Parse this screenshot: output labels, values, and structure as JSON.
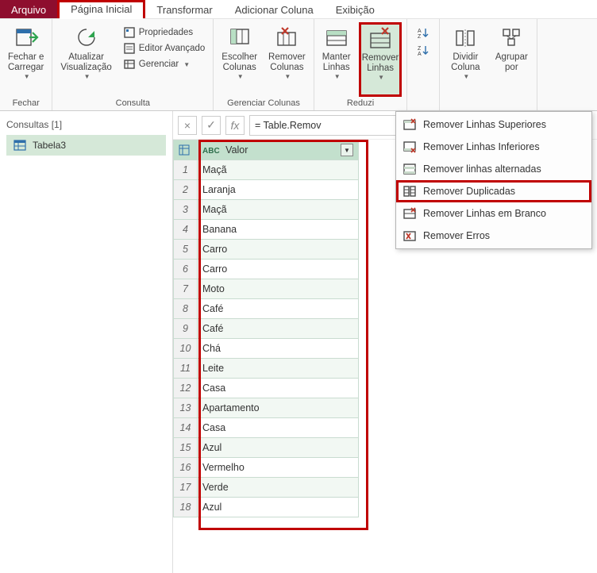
{
  "tabs": {
    "arquivo": "Arquivo",
    "pagina_inicial": "Página Inicial",
    "transformar": "Transformar",
    "adicionar_coluna": "Adicionar Coluna",
    "exibicao": "Exibição"
  },
  "ribbon": {
    "fechar": {
      "fechar_carregar": "Fechar e\nCarregar",
      "group_label": "Fechar"
    },
    "consulta": {
      "atualizar": "Atualizar\nVisualização",
      "propriedades": "Propriedades",
      "editor_avancado": "Editor Avançado",
      "gerenciar": "Gerenciar",
      "group_label": "Consulta"
    },
    "colunas": {
      "escolher": "Escolher\nColunas",
      "remover": "Remover\nColunas",
      "group_label": "Gerenciar Colunas"
    },
    "linhas": {
      "manter": "Manter\nLinhas",
      "remover": "Remover\nLinhas",
      "group_label": "Reduzi"
    },
    "ordem": {
      "dividir": "Dividir\nColuna",
      "agrupar": "Agrupar\npor"
    }
  },
  "dropdown": {
    "rem_superiores": "Remover Linhas Superiores",
    "rem_inferiores": "Remover Linhas Inferiores",
    "rem_alternadas": "Remover linhas alternadas",
    "rem_duplicadas": "Remover Duplicadas",
    "rem_branco": "Remover Linhas em Branco",
    "rem_erros": "Remover Erros"
  },
  "sidebar": {
    "title": "Consultas [1]",
    "query_name": "Tabela3"
  },
  "formula": {
    "text": "= Table.Remov"
  },
  "table": {
    "type_tag": "ABC",
    "column_header": "Valor",
    "rows": [
      "Maçã",
      "Laranja",
      "Maçã",
      "Banana",
      "Carro",
      "Carro",
      "Moto",
      "Café",
      "Café",
      "Chá",
      "Leite",
      "Casa",
      "Apartamento",
      "Casa",
      "Azul",
      "Vermelho",
      "Verde",
      "Azul"
    ]
  }
}
